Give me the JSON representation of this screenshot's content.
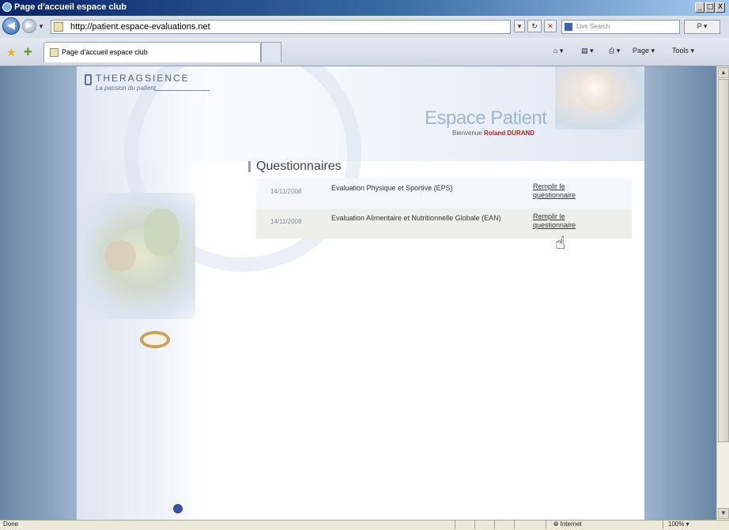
{
  "window": {
    "title": "Page d'accueil espace club",
    "controls": [
      "_",
      "□",
      "X"
    ]
  },
  "toolbar": {
    "url": "http://patient.espace-evaluations.net",
    "search_placeholder": "Live Search",
    "search_go": "P ▾",
    "back_glyph": "◀",
    "forward_glyph": "▶"
  },
  "tabs": {
    "active_title": "Page d'accueil espace club",
    "commands": {
      "home": "⌂ ▾",
      "feeds": "▤ ▾",
      "print": "⎙ ▾",
      "page": "Page ▾",
      "tools": "Tools ▾"
    }
  },
  "page": {
    "logo": {
      "name": "THERAGSIENCE",
      "tagline": "La passion du patient"
    },
    "header_title": "Espace Patient",
    "welcome": {
      "prefix": "Bienvenue",
      "user": "Roland DURAND"
    },
    "section_title": "Questionnaires",
    "questionnaires": [
      {
        "date": "14/11/2008",
        "name": "Evaluation Physique et Sportive (EPS)",
        "link": "Remplir le questionnaire"
      },
      {
        "date": "14/11/2008",
        "name": "Evaluation Alimentaire et Nutritionnelle Globale (EAN)",
        "link": "Remplir le questionnaire"
      }
    ]
  },
  "statusbar": {
    "text": "Done",
    "zone": "Internet",
    "zoom": "100% ▾"
  },
  "colors": {
    "titlebar": "#0a246a",
    "accent_red": "#c21f1f",
    "header_title": "#9fb6cf"
  }
}
